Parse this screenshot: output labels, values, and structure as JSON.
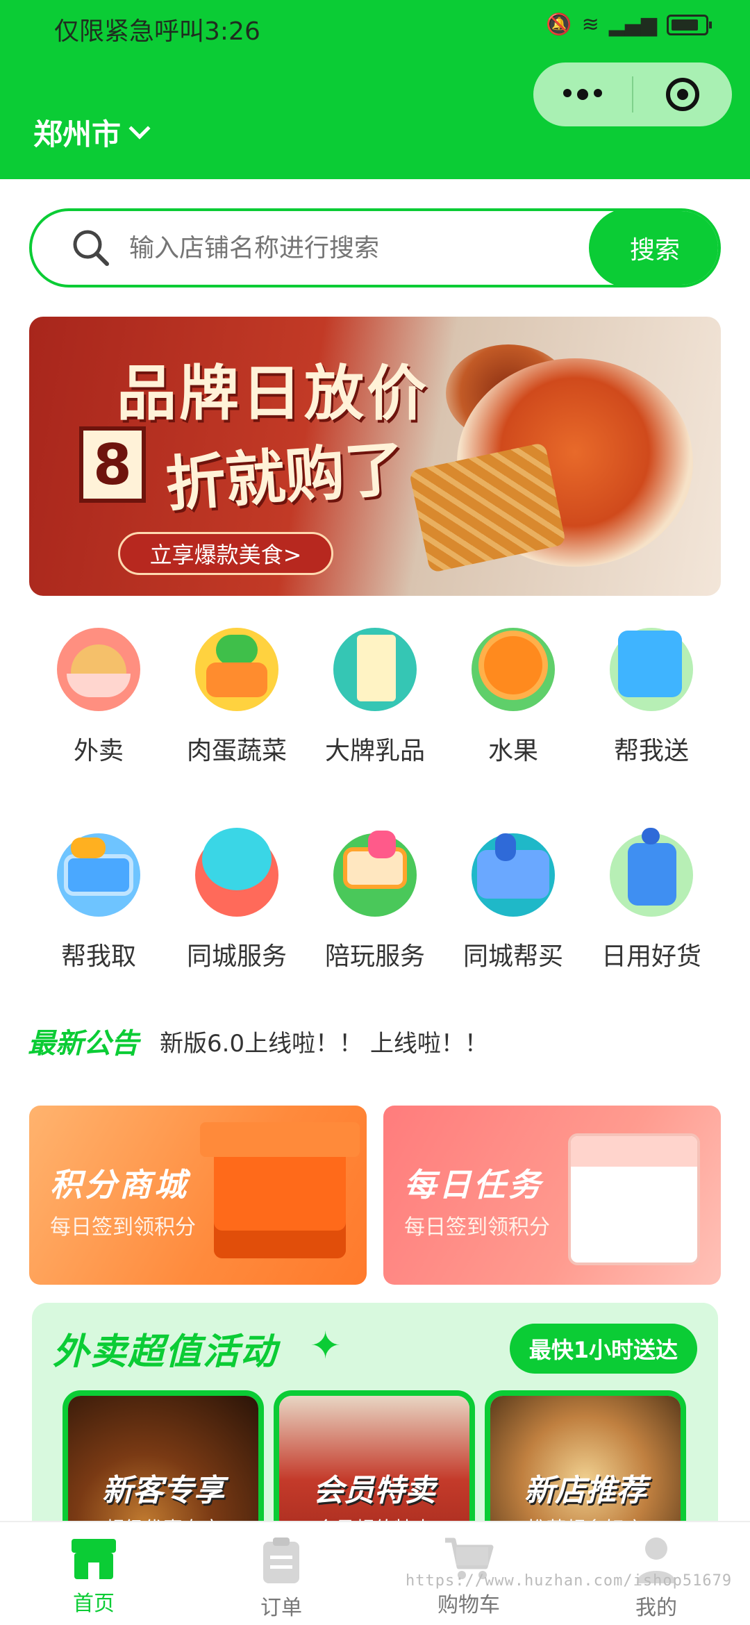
{
  "status_bar": {
    "text": "仅限紧急呼叫3:26"
  },
  "header": {
    "city": "郑州市"
  },
  "search": {
    "placeholder": "输入店铺名称进行搜索",
    "button": "搜索"
  },
  "banner": {
    "title": "品牌日放价",
    "number": "8",
    "subtitle": "折就购了",
    "cta": "立享爆款美食>"
  },
  "categories": [
    {
      "label": "外卖",
      "icon": "takeout-bowl-icon"
    },
    {
      "label": "肉蛋蔬菜",
      "icon": "vegetable-basket-icon"
    },
    {
      "label": "大牌乳品",
      "icon": "milk-carton-icon"
    },
    {
      "label": "水果",
      "icon": "orange-icon"
    },
    {
      "label": "帮我送",
      "icon": "delivery-bag-icon"
    },
    {
      "label": "帮我取",
      "icon": "pickup-basket-icon"
    },
    {
      "label": "同城服务",
      "icon": "heart-plus-icon"
    },
    {
      "label": "陪玩服务",
      "icon": "game-box-icon"
    },
    {
      "label": "同城帮买",
      "icon": "shopping-box-icon"
    },
    {
      "label": "日用好货",
      "icon": "soap-bottle-icon"
    }
  ],
  "notice": {
    "title": "最新公告",
    "text": "新版6.0上线啦！！ 上线啦！！"
  },
  "promos": [
    {
      "title": "积分商城",
      "subtitle": "每日签到领积分"
    },
    {
      "title": "每日任务",
      "subtitle": "每日签到领积分"
    }
  ],
  "activity": {
    "title": "外卖超值活动",
    "badge": "最快1小时送达",
    "cards": [
      {
        "title": "新客专享",
        "subtitle": "超级优惠专享"
      },
      {
        "title": "会员特卖",
        "subtitle": "会员超值特卖"
      },
      {
        "title": "新店推荐",
        "subtitle": "推荐超多好店"
      }
    ]
  },
  "tabbar": [
    {
      "label": "首页",
      "active": true
    },
    {
      "label": "订单",
      "active": false
    },
    {
      "label": "购物车",
      "active": false
    },
    {
      "label": "我的",
      "active": false
    }
  ],
  "watermark": "https://www.huzhan.com/ishop51679",
  "colors": {
    "brand_green": "#0bcc35",
    "capsule": "#a9f0b3",
    "activity_bg": "#d8f9de"
  }
}
